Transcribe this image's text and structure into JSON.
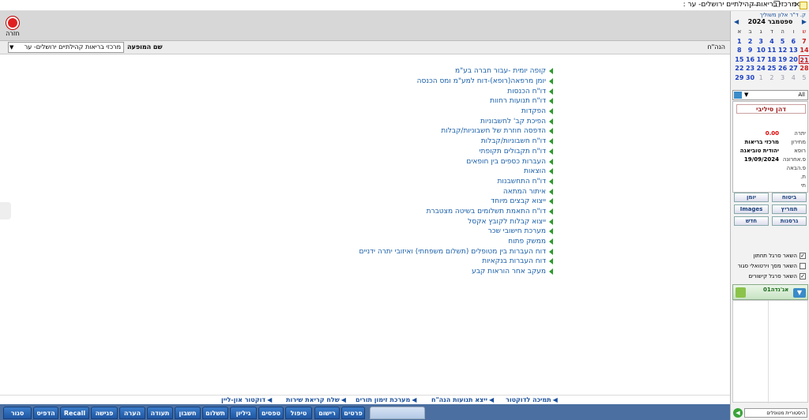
{
  "window": {
    "title": "מרכזי בריאות קהילתיים ירושלים- ער :",
    "minimize": "—",
    "restore": "❐",
    "close": "✕"
  },
  "toolbar": {
    "exit_label": "חזרה"
  },
  "subheader": {
    "show_as_label": "שם  המופעה",
    "clinic_value": "מרכזי בריאות קהילתיים ירושלים- ער",
    "short_code": "הנה\"ח"
  },
  "main_links": [
    "קופה יומית  -עבור חברה בע\"מ",
    "יומן מרפאה(רופא)-דוח למע\"מ ומס הכנסה",
    "דו\"ח הכנסות",
    "דו\"ח תנועות רחוות",
    "הפקדות",
    "הפיכת קב' לחשבוניות",
    "הדפסה חוזרת של חשבוניות/קבלות",
    "דו\"ח חשבוניות/קבלות",
    "דו\"ח תקבולים תקופתי",
    "העברות כספים בין חופאים",
    "הוצאות",
    "דו\"ח התחשבנות",
    "איתור המתאה",
    "ייצוא קבצים מיוחד",
    "דו\"ח התאמת תשלומים בשיטה מצטברת",
    "ייצוא קבלות לקובץ אקסל",
    "מערכת חישובי שכר",
    "ממשק פתוח",
    "דוח העברות בין מטופלים (תשלום משפחתי) ואיזובי יתרה ידניים",
    "דוח העברות בנקאיות",
    "מעקב אחר הוראות קבע"
  ],
  "bottom_links": [
    "דוקטור און-ליין",
    "שלח קריאת שירות",
    "מערכת זימון תורים",
    "ייצא תנועות הנה\"ח",
    "תמיכה לדוקטור"
  ],
  "tabs": [
    "פרטים",
    "רישום",
    "טיפול",
    "טפסים",
    "גיליון",
    "תשלום",
    "חשבון",
    "תעודה",
    "הערה",
    "פגישה",
    "Recall",
    "הדפיס",
    "סגור הכל"
  ],
  "right_panel": {
    "doctor_link": "ק. ד\"ר אלון משוליך",
    "calendar": {
      "month_label": "ספטמבר 2024",
      "prev": "◀",
      "next": "▶",
      "weekday_headers": [
        "ש",
        "ו",
        "ה",
        "ד",
        "ג",
        "ב",
        "א"
      ],
      "weeks": [
        [
          "1",
          "2",
          "3",
          "4",
          "5",
          "6",
          "7"
        ],
        [
          "8",
          "9",
          "10",
          "11",
          "12",
          "13",
          "14"
        ],
        [
          "15",
          "16",
          "17",
          "18",
          "19",
          "20",
          "21"
        ],
        [
          "22",
          "23",
          "24",
          "25",
          "26",
          "27",
          "28"
        ],
        [
          "29",
          "30",
          "1",
          "2",
          "3",
          "4",
          "5"
        ]
      ],
      "today": "21"
    },
    "filter_value": "All",
    "patient": {
      "name": "דהן סיליבי",
      "rows": [
        {
          "key": "יתרה",
          "value": "0.00"
        },
        {
          "key": "מחירון",
          "value": "מרכזי בריאות"
        },
        {
          "key": "רופא",
          "value": "יהודית טוביאנה"
        },
        {
          "key": "פ.אחרונה",
          "value": "19/09/2024"
        },
        {
          "key": "פ.הבאה",
          "value": ""
        },
        {
          "key": "ת.",
          "value": ""
        },
        {
          "key": "תי",
          "value": ""
        }
      ]
    },
    "buttons": [
      "ביטוח",
      "יומן",
      "תמריץ",
      "Images",
      "גרסנות",
      "חדש"
    ],
    "checkboxes": [
      {
        "label": "השאר סרגל תחתון",
        "checked": true
      },
      {
        "label": "השאר מסך וירטואלי סגור",
        "checked": false
      },
      {
        "label": "השאר סרגל קישורים",
        "checked": true
      }
    ],
    "agenda_label": "אג'נדה01",
    "bottom_select": "היסטוריית מטופלים"
  },
  "colors": {
    "link": "#1a5fa8",
    "accent_green": "#2e9a2e",
    "tab_blue": "#1f57a3",
    "saturday_red": "#c81c1c"
  }
}
